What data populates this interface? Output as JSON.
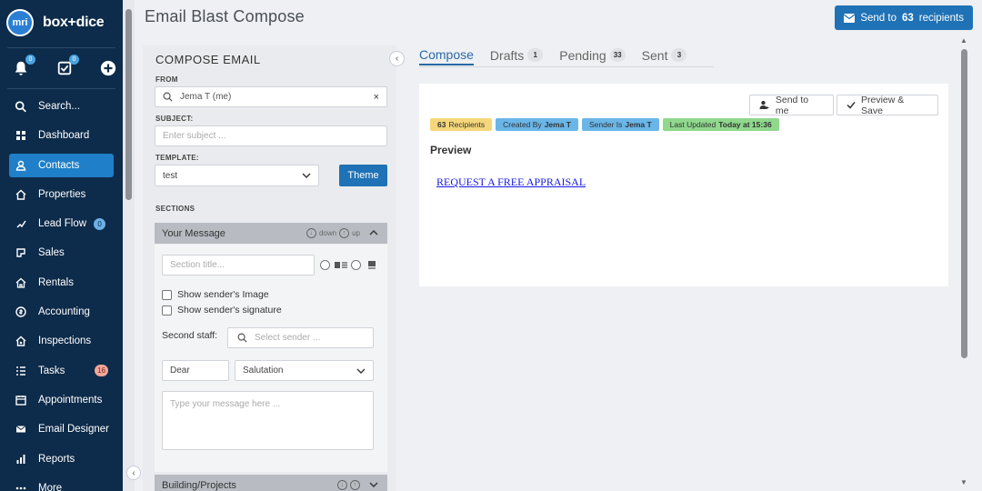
{
  "app": {
    "logo_badge": "mri",
    "logo_text": "box+dice"
  },
  "sidebar": {
    "notif_count": "0",
    "task_count": "0",
    "items": [
      {
        "label": "Search...",
        "icon": "search-icon"
      },
      {
        "label": "Dashboard",
        "icon": "dashboard-icon"
      },
      {
        "label": "Contacts",
        "icon": "contacts-icon",
        "active": true
      },
      {
        "label": "Properties",
        "icon": "properties-icon"
      },
      {
        "label": "Lead Flow",
        "icon": "leadflow-icon",
        "badge": "0"
      },
      {
        "label": "Sales",
        "icon": "sales-icon"
      },
      {
        "label": "Rentals",
        "icon": "rentals-icon"
      },
      {
        "label": "Accounting",
        "icon": "accounting-icon"
      },
      {
        "label": "Inspections",
        "icon": "inspections-icon"
      },
      {
        "label": "Tasks",
        "icon": "tasks-icon",
        "badge": "16"
      },
      {
        "label": "Appointments",
        "icon": "appointments-icon"
      },
      {
        "label": "Email Designer",
        "icon": "email-designer-icon"
      },
      {
        "label": "Reports",
        "icon": "reports-icon"
      },
      {
        "label": "More",
        "icon": "more-icon"
      }
    ]
  },
  "header": {
    "title": "Email Blast Compose",
    "send_prefix": "Send to",
    "send_count": "63",
    "send_suffix": "recipients"
  },
  "compose": {
    "title": "COMPOSE EMAIL",
    "from_label": "FROM",
    "from_value": "Jema T (me)",
    "subject_label": "SUBJECT:",
    "subject_placeholder": "Enter subject ...",
    "template_label": "TEMPLATE:",
    "template_value": "test",
    "theme_button": "Theme",
    "sections_label": "SECTIONS",
    "section1": {
      "title": "Your Message",
      "down": "down",
      "up": "up",
      "section_title_placeholder": "Section title...",
      "show_image": "Show sender's Image",
      "show_signature": "Show sender's signature",
      "second_staff_label": "Second staff:",
      "select_sender_placeholder": "Select sender ...",
      "dear": "Dear",
      "salutation": "Salutation",
      "message_placeholder": "Type your message here ..."
    },
    "section2": {
      "title": "Building/Projects"
    }
  },
  "tabs": [
    {
      "label": "Compose",
      "active": true
    },
    {
      "label": "Drafts",
      "count": "1"
    },
    {
      "label": "Pending",
      "count": "33"
    },
    {
      "label": "Sent",
      "count": "3"
    }
  ],
  "preview": {
    "send_to_me": "Send to me",
    "preview_save": "Preview & Save",
    "chips": {
      "recipients_count": "63",
      "recipients_label": "Recipients",
      "created_by_label": "Created By",
      "created_by_value": "Jema T",
      "sender_label": "Sender Is",
      "sender_value": "Jema T",
      "updated_label": "Last Updated",
      "updated_value": "Today at 15:36"
    },
    "heading": "Preview",
    "link_text": "REQUEST A FREE APPRAISAL"
  },
  "colors": {
    "sidebar_bg": "#0d2b4a",
    "accent": "#1f72b5",
    "chip_yellow": "#f5d77b",
    "chip_blue": "#6ab6e8",
    "chip_green": "#8fd88c"
  }
}
